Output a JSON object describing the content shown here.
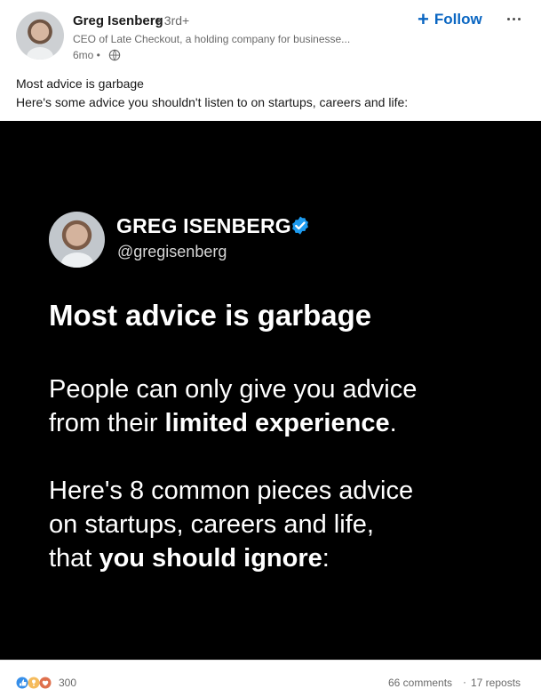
{
  "post": {
    "author": {
      "name": "Greg Isenberg",
      "degree": "• 3rd+",
      "headline": "CEO of Late Checkout, a holding company for businesse...",
      "time": "6mo •"
    },
    "actions": {
      "follow": "Follow",
      "follow_icon": "plus-icon",
      "more_icon": "more-options-icon"
    },
    "text": {
      "line1": "Most advice is garbage",
      "line2": "Here's some advice you shouldn't listen to on startups, careers and life:"
    },
    "image": {
      "name": "GREG ISENBERG",
      "handle": "@gregisenberg",
      "title": "Most advice is garbage",
      "paragraph1": {
        "line1": "People can only give you advice",
        "line2_prefix": "from their ",
        "line2_bold": "limited experience",
        "line2_suffix": "."
      },
      "paragraph2": {
        "line1": "Here's 8 common pieces advice",
        "line2": "on startups, careers and life,",
        "line3_prefix": "that ",
        "line3_bold": "you should ignore",
        "line3_suffix": ":"
      }
    },
    "footer": {
      "reactions": "300",
      "comments": "66 comments",
      "separator": "·",
      "reposts": "17 reposts"
    }
  },
  "colors": {
    "accent": "#0a66c2",
    "verified": "#1d9bf0",
    "image_background": "#000000",
    "image_text": "#ffffff"
  }
}
